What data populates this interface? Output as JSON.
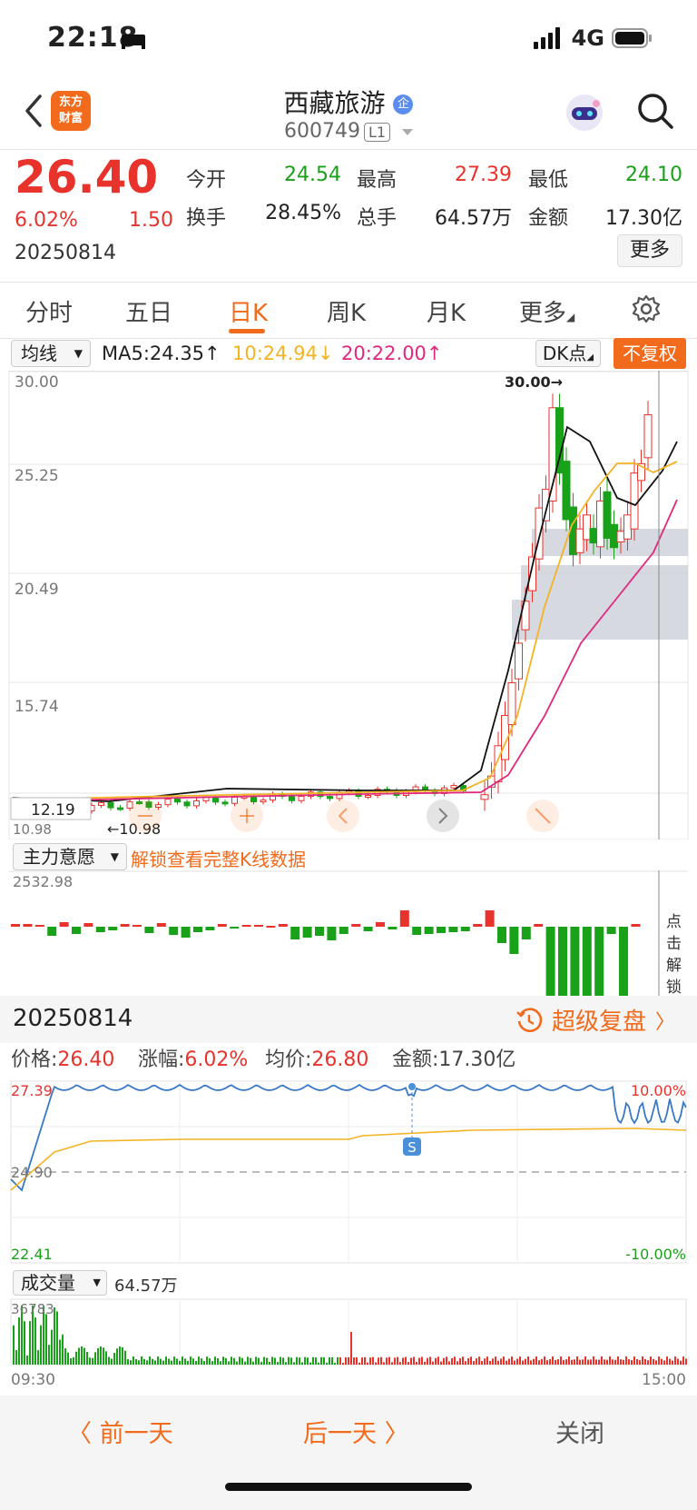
{
  "status_bar": {
    "time": "22:18",
    "network": "4G"
  },
  "header": {
    "title": "西藏旅游",
    "code": "600749",
    "level": "L1",
    "logo_line1": "东方",
    "logo_line2": "财富",
    "badge": "企"
  },
  "quote": {
    "price": "26.40",
    "pct": "6.02%",
    "change": "1.50",
    "date": "20250814",
    "fields": [
      {
        "label": "今开",
        "value": "24.54",
        "color": "green"
      },
      {
        "label": "最高",
        "value": "27.39",
        "color": "red"
      },
      {
        "label": "最低",
        "value": "24.10",
        "color": "green"
      },
      {
        "label": "换手",
        "value": "28.45%",
        "color": "black"
      },
      {
        "label": "总手",
        "value": "64.57万",
        "color": "black"
      },
      {
        "label": "金额",
        "value": "17.30亿",
        "color": "black"
      }
    ],
    "more_label": "更多"
  },
  "tabs": [
    "分时",
    "五日",
    "日K",
    "周K",
    "月K",
    "更多"
  ],
  "active_tab": "日K",
  "ma_bar": {
    "select_label": "均线",
    "ma5": "MA5:24.35↑",
    "ma10": "10:24.94↓",
    "ma20": "20:22.00↑",
    "dk_label": "DK点",
    "fq_label": "不复权"
  },
  "kline": {
    "y_ticks": [
      "30.00",
      "25.25",
      "20.49",
      "15.74"
    ],
    "cursor_price": "12.19",
    "low_label": "10.98",
    "low_marker": "10.98",
    "high_label": "30.00→",
    "colors": {
      "up": "#e8322c",
      "down": "#1aa11a",
      "ma5": "#111111",
      "ma10": "#f4b324",
      "ma20": "#e0287f"
    }
  },
  "sub_indicator": {
    "select_label": "主力意愿",
    "unlock_text": "解锁查看完整K线数据",
    "max_value": "2532.98",
    "side_unlock": "点击解锁"
  },
  "replay": {
    "date": "20250814",
    "review_label": "超级复盘",
    "price_label": "价格:",
    "price_value": "26.40",
    "pct_label": "涨幅:",
    "pct_value": "6.02%",
    "avg_label": "均价:",
    "avg_value": "26.80",
    "amount_label": "金额:",
    "amount_value": "17.30亿",
    "y_top": "27.39",
    "y_mid": "24.90",
    "y_bottom": "22.41",
    "pct_top": "10.00%",
    "pct_bottom": "-10.00%",
    "marker": "S"
  },
  "volume": {
    "select_label": "成交量",
    "value": "64.57万",
    "max": "36783",
    "time_start": "09:30",
    "time_end": "15:00"
  },
  "footer": {
    "prev": "〈 前一天",
    "next": "后一天 〉",
    "close": "关闭"
  }
}
